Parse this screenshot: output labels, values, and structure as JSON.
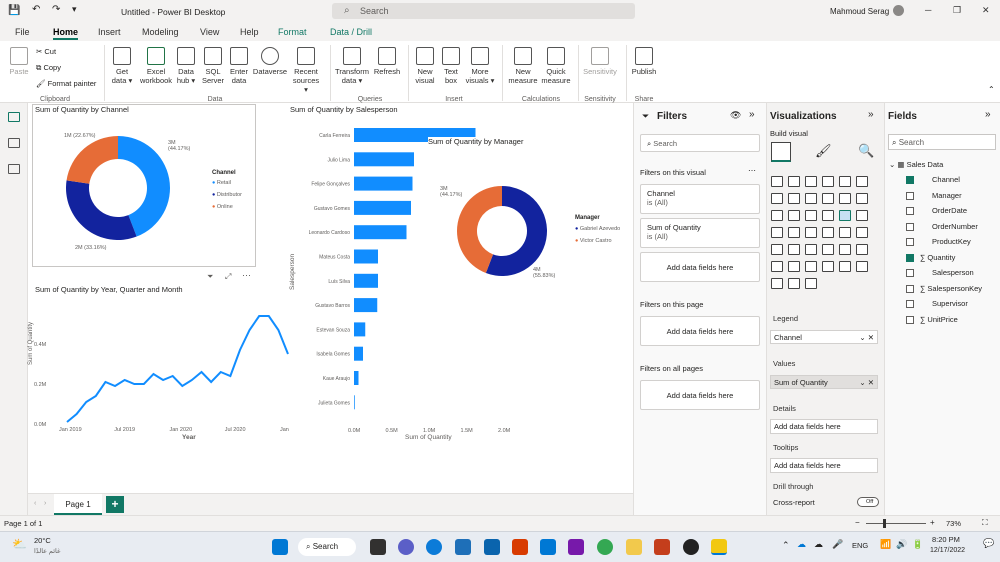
{
  "titlebar": {
    "title": "Untitled - Power BI Desktop",
    "search_placeholder": "Search",
    "user": "Mahmoud Serag"
  },
  "menu": [
    "File",
    "Home",
    "Insert",
    "Modeling",
    "View",
    "Help",
    "Format",
    "Data / Drill"
  ],
  "ribbon": {
    "clipboard": {
      "paste": "Paste",
      "cut": "Cut",
      "copy": "Copy",
      "format_painter": "Format painter",
      "group": "Clipboard"
    },
    "data": {
      "get_data": "Get data",
      "excel": "Excel workbook",
      "data_hub": "Data hub",
      "sql": "SQL Server",
      "enter": "Enter data",
      "dataverse": "Dataverse",
      "recent": "Recent sources",
      "group": "Data"
    },
    "queries": {
      "transform": "Transform data",
      "refresh": "Refresh",
      "group": "Queries"
    },
    "insert": {
      "new_visual": "New visual",
      "text_box": "Text box",
      "more_visuals": "More visuals",
      "group": "Insert"
    },
    "calculations": {
      "new_measure": "New measure",
      "quick_measure": "Quick measure",
      "group": "Calculations"
    },
    "sensitivity": {
      "label": "Sensitivity",
      "group": "Sensitivity"
    },
    "share": {
      "publish": "Publish",
      "group": "Share"
    }
  },
  "donut_channel": {
    "title": "Sum of Quantity by Channel",
    "legend_title": "Channel",
    "legend": [
      "Retail",
      "Distributor",
      "Online"
    ],
    "labels": {
      "retail": "3M\n(44.17%)",
      "distributor": "2M (33.16%)",
      "online": "1M (22.67%)"
    }
  },
  "line_chart": {
    "title": "Sum of Quantity by Year, Quarter and Month",
    "ylabel": "Sum of Quantity",
    "xlabel": "Year",
    "yticks": [
      "0.4M",
      "0.2M",
      "0.0M"
    ],
    "xticks": [
      "Jan 2019",
      "Jul 2019",
      "Jan 2020",
      "Jul 2020",
      "Jan"
    ]
  },
  "bar_chart": {
    "title": "Sum of Quantity by Salesperson",
    "ylabel": "Salesperson",
    "xlabel": "Sum of Quantity",
    "xticks": [
      "0.0M",
      "0.5M",
      "1.0M",
      "1.5M",
      "2.0M"
    ],
    "people": [
      "Carla Ferreira",
      "Julio Lima",
      "Felipe Gonçalves",
      "Gustavo Gomes",
      "Leonardo Cardoso",
      "Mateus Costa",
      "Luís Silva",
      "Gustavo Barros",
      "Estevan Souza",
      "Isabela Gomes",
      "Kaue Araujo",
      "Julieta Gomes"
    ]
  },
  "donut_manager": {
    "title": "Sum of Quantity by Manager",
    "legend_title": "Manager",
    "legend": [
      "Gabriel Azevedo",
      "Victor Castro"
    ],
    "labels": {
      "a": "4M\n(55.83%)",
      "b": "3M\n(44.17%)"
    }
  },
  "chart_data": [
    {
      "type": "pie",
      "title": "Sum of Quantity by Channel",
      "categories": [
        "Retail",
        "Distributor",
        "Online"
      ],
      "values": [
        3,
        2,
        1
      ],
      "percent": [
        44.17,
        33.16,
        22.67
      ]
    },
    {
      "type": "line",
      "title": "Sum of Quantity by Year, Quarter and Month",
      "xlabel": "Year",
      "ylabel": "Sum of Quantity",
      "x": [
        "Jan 2019",
        "Feb 2019",
        "Mar 2019",
        "Apr 2019",
        "May 2019",
        "Jun 2019",
        "Jul 2019",
        "Aug 2019",
        "Sep 2019",
        "Oct 2019",
        "Nov 2019",
        "Dec 2019",
        "Jan 2020",
        "Feb 2020",
        "Mar 2020",
        "Apr 2020",
        "May 2020",
        "Jun 2020",
        "Jul 2020",
        "Aug 2020",
        "Sep 2020",
        "Oct 2020",
        "Nov 2020",
        "Dec 2020"
      ],
      "values": [
        0.01,
        0.05,
        0.11,
        0.14,
        0.21,
        0.19,
        0.22,
        0.2,
        0.2,
        0.25,
        0.22,
        0.24,
        0.19,
        0.22,
        0.26,
        0.21,
        0.26,
        0.24,
        0.37,
        0.47,
        0.54,
        0.54,
        0.47,
        0.35
      ],
      "ylim": [
        0,
        0.55
      ]
    },
    {
      "type": "bar",
      "title": "Sum of Quantity by Salesperson",
      "xlabel": "Sum of Quantity",
      "ylabel": "Salesperson",
      "categories": [
        "Carla Ferreira",
        "Julio Lima",
        "Felipe Gonçalves",
        "Gustavo Gomes",
        "Leonardo Cardoso",
        "Mateus Costa",
        "Luís Silva",
        "Gustavo Barros",
        "Estevan Souza",
        "Isabela Gomes",
        "Kaue Araujo",
        "Julieta Gomes"
      ],
      "values": [
        1.62,
        0.8,
        0.78,
        0.76,
        0.7,
        0.32,
        0.32,
        0.31,
        0.15,
        0.12,
        0.06,
        0.01
      ],
      "xlim": [
        0,
        2.0
      ]
    },
    {
      "type": "pie",
      "title": "Sum of Quantity by Manager",
      "categories": [
        "Gabriel Azevedo",
        "Victor Castro"
      ],
      "values": [
        4,
        3
      ],
      "percent": [
        55.83,
        44.17
      ]
    }
  ],
  "filters": {
    "title": "Filters",
    "search": "Search",
    "on_visual": "Filters on this visual",
    "card1_name": "Channel",
    "card1_val": "is (All)",
    "card2_name": "Sum of Quantity",
    "card2_val": "is (All)",
    "add": "Add data fields here",
    "on_page": "Filters on this page",
    "on_all": "Filters on all pages"
  },
  "visualizations": {
    "title": "Visualizations",
    "build": "Build visual",
    "legend": "Legend",
    "legend_val": "Channel",
    "values": "Values",
    "values_val": "Sum of Quantity",
    "details": "Details",
    "tooltips": "Tooltips",
    "add": "Add data fields here",
    "drill": "Drill through",
    "cross": "Cross-report",
    "toggle": "Off"
  },
  "fields": {
    "title": "Fields",
    "search": "Search",
    "table": "Sales Data",
    "items": [
      {
        "name": "Channel",
        "checked": true
      },
      {
        "name": "Manager",
        "checked": false
      },
      {
        "name": "OrderDate",
        "checked": false
      },
      {
        "name": "OrderNumber",
        "checked": false
      },
      {
        "name": "ProductKey",
        "checked": false
      },
      {
        "name": "Quantity",
        "checked": true
      },
      {
        "name": "Salesperson",
        "checked": false
      },
      {
        "name": "SalespersonKey",
        "checked": false
      },
      {
        "name": "Supervisor",
        "checked": false
      },
      {
        "name": "UnitPrice",
        "checked": false
      }
    ]
  },
  "tabs": {
    "page": "Page 1",
    "add": "+"
  },
  "status": {
    "page": "Page 1 of 1",
    "zoom": "73%"
  },
  "taskbar": {
    "temp": "20°C",
    "weather": "غائم عالدًا",
    "search": "Search",
    "lang": "ENG",
    "time": "8:20 PM",
    "date": "12/17/2022"
  },
  "colors": {
    "blue": "#118dff",
    "navy": "#12239e",
    "orange": "#e66c37",
    "accent": "#117865"
  }
}
